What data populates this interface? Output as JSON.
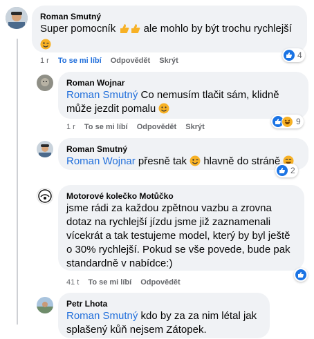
{
  "comments": [
    {
      "author": "Roman Smutný",
      "text_before": "Super pomocník ",
      "text_after": " ale mohlo by být trochu rychlejší",
      "age": "1 r",
      "like_label": "To se mi líbí",
      "reply_label": "Odpovědět",
      "hide_label": "Skrýt",
      "reaction_count": "4"
    },
    {
      "author": "Roman Wojnar",
      "mention": "Roman Smutný",
      "text": " Co nemusím tlačit sám, klidně může jezdit pomalu ",
      "age": "1 r",
      "like_label": "To se mi líbí",
      "reply_label": "Odpovědět",
      "hide_label": "Skrýt",
      "reaction_count": "9"
    },
    {
      "author": "Roman Smutný",
      "mention": "Roman Wojnar",
      "text_before": " přesně tak ",
      "text_after": " hlavně do stráně ",
      "age": "1 r",
      "like_label": "To se mi líbí",
      "reply_label": "Odpovědět",
      "hide_label": "Skrýt",
      "reaction_count": "2"
    },
    {
      "author": "Motorové kolečko Motůčko",
      "text": "jsme rádi za každou zpětnou vazbu a zrovna dotaz na rychlejší jízdu jsme již zaznamenali vícekrát a tak testujeme model, který by byl ještě o 30% rychlejší. Pokud se vše povede, bude pak standardně v nabídce:)",
      "age": "41 t",
      "like_label": "To se mi líbí",
      "reply_label": "Odpovědět"
    },
    {
      "author": "Petr Lhota",
      "mention": "Roman Smutný",
      "text": " kdo by za za nim létal jak splašený kůň nejsem Zátopek."
    }
  ],
  "colors": {
    "link": "#216fdb",
    "bubble": "#f0f2f5",
    "like": "#1b74e4",
    "haha": "#f7b125",
    "meta": "#65676b"
  },
  "icons": [
    "avatar-photo",
    "thumbs-up-emoji",
    "wink-emoji",
    "smile-emoji",
    "laugh-emoji",
    "like-icon",
    "haha-icon",
    "page-logo"
  ]
}
